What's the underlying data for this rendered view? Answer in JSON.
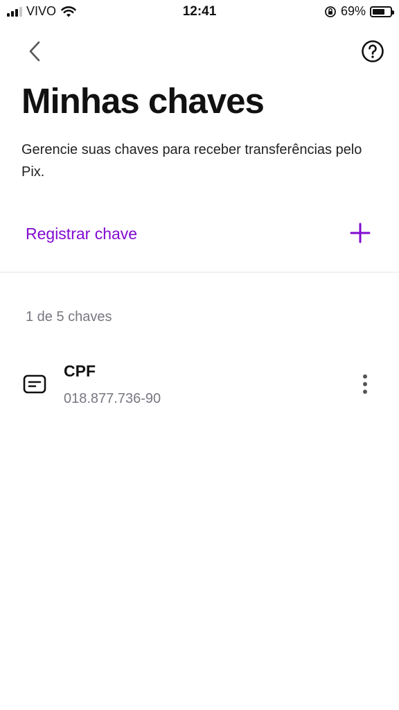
{
  "status_bar": {
    "carrier": "VIVO",
    "time": "12:41",
    "battery": "69%",
    "battery_level": 0.69
  },
  "header": {
    "back_icon": "chevron-left-icon",
    "help_icon": "question-circle-icon"
  },
  "page": {
    "title": "Minhas chaves",
    "description": "Gerencie suas chaves para receber transferências pelo Pix."
  },
  "register": {
    "label": "Registrar chave",
    "icon": "plus-icon"
  },
  "keys": {
    "count_label": "1 de 5 chaves",
    "items": [
      {
        "type": "CPF",
        "value": "018.877.736-90",
        "icon": "id-card-icon",
        "menu_icon": "more-vertical-icon"
      }
    ]
  },
  "colors": {
    "accent": "#820ad1",
    "text": "#111111",
    "muted": "#777780"
  }
}
